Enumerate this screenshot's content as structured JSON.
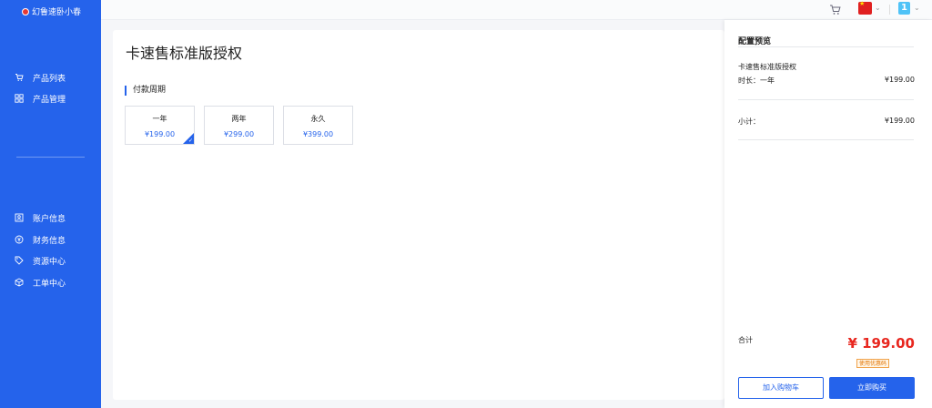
{
  "logo": {
    "text": "幻鲁速卧小春"
  },
  "sidebar": {
    "items_top": [
      {
        "label": "产品列表",
        "icon": "cart-icon"
      },
      {
        "label": "产品管理",
        "icon": "grid-icon"
      }
    ],
    "items_bottom": [
      {
        "label": "账户信息",
        "icon": "account-icon"
      },
      {
        "label": "财务信息",
        "icon": "finance-icon"
      },
      {
        "label": "资源中心",
        "icon": "tag-icon"
      },
      {
        "label": "工单中心",
        "icon": "box-icon"
      }
    ]
  },
  "topbar": {
    "user_badge": "1",
    "flag": "china-flag-icon"
  },
  "main": {
    "title": "卡速售标准版授权",
    "section_label": "付款周期",
    "periods": [
      {
        "name": "一年",
        "price": "¥199.00",
        "selected": true
      },
      {
        "name": "两年",
        "price": "¥299.00",
        "selected": false
      },
      {
        "name": "永久",
        "price": "¥399.00",
        "selected": false
      }
    ]
  },
  "panel": {
    "title": "配置预览",
    "product_name": "卡速售标准版授权",
    "duration_label": "时长：一年",
    "duration_price": "¥199.00",
    "subtotal_label": "小计：",
    "subtotal_value": "¥199.00",
    "total_label": "合计",
    "total_value": "¥ 199.00",
    "coupon_label": "使用优惠码",
    "add_cart_label": "加入购物车",
    "buy_now_label": "立即购买"
  },
  "colors": {
    "primary": "#2563eb",
    "price_red": "#e8271f",
    "coupon_orange": "#e37400"
  }
}
